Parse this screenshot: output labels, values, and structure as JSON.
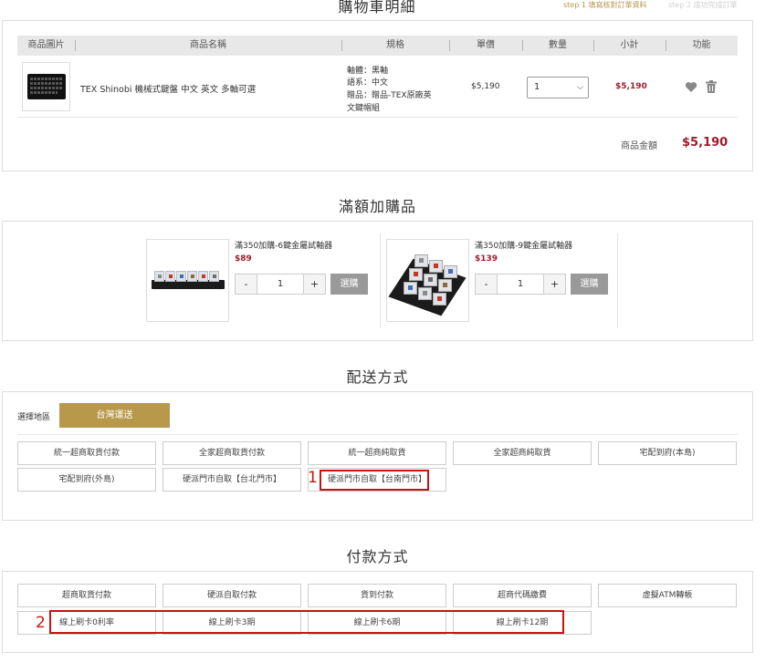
{
  "cart": {
    "title": "購物車明細",
    "steps": [
      "step 1 填寫核對訂單資料",
      "step 2 成功完成訂單"
    ],
    "columns": [
      "商品圖片",
      "商品名稱",
      "規格",
      "單價",
      "數量",
      "小計",
      "功能"
    ],
    "item": {
      "name": "TEX Shinobi 機械式鍵盤 中文 英文 多軸可選",
      "spec": [
        "軸體：黑軸",
        "語系：中文",
        "贈品：贈品-TEX原廠英",
        "文鍵帽組"
      ],
      "unit_price": "$5,190",
      "qty": "1",
      "subtotal": "$5,190"
    },
    "total_label": "商品金額",
    "total_value": "$5,190"
  },
  "addon": {
    "title": "滿額加購品",
    "items": [
      {
        "name": "滿350加購-6鍵金屬試軸器",
        "price": "$89",
        "qty": "1",
        "minus": "-",
        "plus": "+",
        "buy": "選購"
      },
      {
        "name": "滿350加購-9鍵金屬試軸器",
        "price": "$139",
        "qty": "1",
        "minus": "-",
        "plus": "+",
        "buy": "選購"
      }
    ]
  },
  "shipping": {
    "title": "配送方式",
    "region_label": "選擇地區",
    "region_tab": "台灣運送",
    "options": [
      "統一超商取貨付款",
      "全家超商取貨付款",
      "統一超商純取貨",
      "全家超商純取貨",
      "宅配到府(本島)",
      "宅配到府(外島)",
      "硬派門市自取【台北門市】",
      "硬派門市自取【台南門市】"
    ],
    "marker": "1"
  },
  "payment": {
    "title": "付款方式",
    "options_row1": [
      "超商取貨付款",
      "硬派自取付款",
      "貨到付款",
      "超商代碼繳費",
      "虛擬ATM轉帳"
    ],
    "options_row2": [
      "線上刷卡0利率",
      "線上刷卡3期",
      "線上刷卡6期",
      "線上刷卡12期"
    ],
    "marker": "2"
  },
  "colors": {
    "accent_gold": "#b8984a",
    "price_red": "#a01a2c",
    "highlight_red": "#cc1111"
  }
}
